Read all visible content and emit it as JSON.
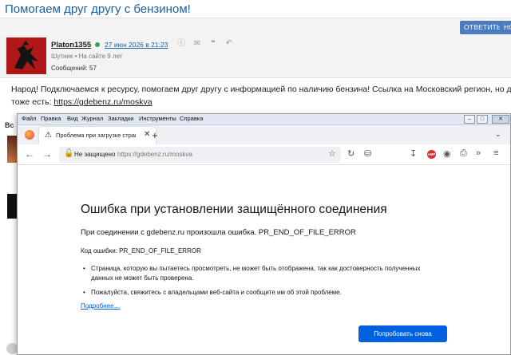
{
  "forum": {
    "topic_title": "Помогаем друг другу с бензином!",
    "reply_button": "ОТВЕТИТЬ",
    "quote_button": "НО",
    "author": {
      "name": "Platon1355",
      "date": "27 июн 2026 в 21:23",
      "rank": "Шутник  •  На сайте 9 лет",
      "posts": "Сообщений: 57"
    },
    "post_line1": "Народ! Подключаемся к ресурсу, помогаем друг другу с информацией по наличию бензина! Ссылка на Московский регион, но другие",
    "post_line2_prefix": "тоже есть: ",
    "post_link": "https://gdebenz.ru/moskva",
    "left_label": "Вс"
  },
  "browser": {
    "menu": [
      "Файл",
      "Правка",
      "Вид",
      "Журнал",
      "Закладки",
      "Инструменты",
      "Справка"
    ],
    "tab_title": "Проблема при загрузке стран",
    "url_security": "Не защищено",
    "url": "https://gdebenz.ru/moskva",
    "icons": [
      "back-icon",
      "forward-icon",
      "reload-icon",
      "lock-warning-icon",
      "star-icon",
      "reader-icon",
      "download-icon",
      "adblock-icon",
      "extensions-icon",
      "overflow-icon",
      "menu-icon"
    ]
  },
  "error_page": {
    "title": "Ошибка при установлении защищённого соединения",
    "main": "При соединении с gdebenz.ru произошла ошибка. PR_END_OF_FILE_ERROR",
    "code": "Код ошибки: PR_END_OF_FILE_ERROR",
    "bullets": [
      "Страница, которую вы пытаетесь просмотреть, не может быть отображена, так как достоверность полученных данных не может быть проверена.",
      "Пожалуйста, свяжитесь с владельцами веб-сайта и сообщите им об этой проблеме."
    ],
    "more_link": "Подробнее…",
    "retry_button": "Попробовать снова"
  },
  "colors": {
    "forum_title": "#1a5f9e",
    "button_blue": "#4a7cc0",
    "online_dot": "#3aa655",
    "ff_blue": "#0061e0",
    "avatar_red": "#b01818"
  }
}
